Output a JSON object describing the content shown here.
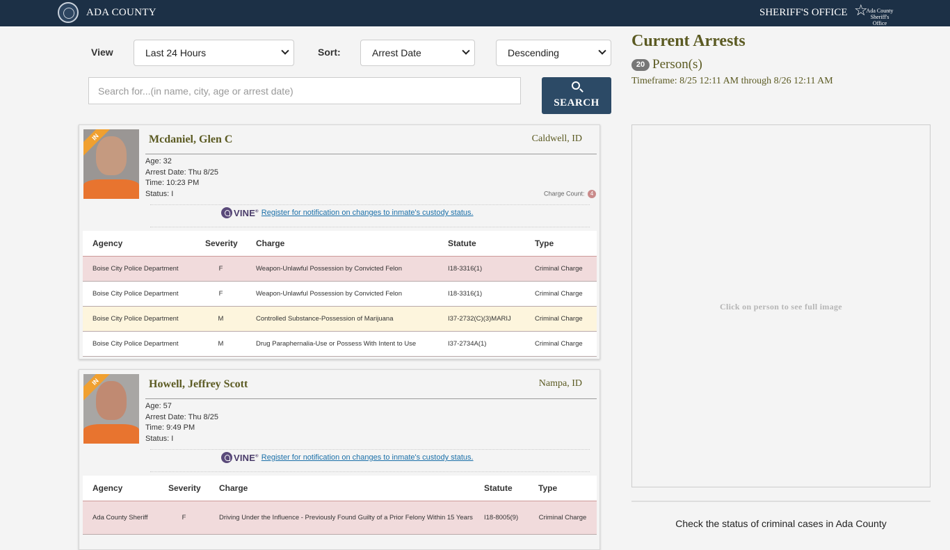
{
  "header": {
    "county": "ADA COUNTY",
    "office": "SHERIFF'S OFFICE",
    "logo_line1": "Ada County",
    "logo_line2": "Sheriff's Office"
  },
  "filters": {
    "view_label": "View",
    "view_value": "Last 24 Hours",
    "sort_label": "Sort:",
    "sort_value": "Arrest Date",
    "order_value": "Descending",
    "search_placeholder": "Search for...(in name, city, age or arrest date)",
    "search_button": "SEARCH"
  },
  "summary": {
    "title": "Current Arrests",
    "count": "20",
    "count_label": "Person(s)",
    "timeframe": "Timeframe: 8/25 12:11 AM through 8/26 12:11 AM"
  },
  "viewer": {
    "hint": "Click on person to see full image"
  },
  "footer": {
    "check_text": "Check the status of criminal cases in Ada County"
  },
  "columns": {
    "agency": "Agency",
    "severity": "Severity",
    "charge": "Charge",
    "statute": "Statute",
    "type": "Type"
  },
  "arrests": [
    {
      "status_ribbon": "IN",
      "name": "Mcdaniel, Glen C",
      "city": "Caldwell, ID",
      "age": "Age: 32",
      "arrest_date": "Arrest Date: Thu 8/25",
      "time": "Time: 10:23 PM",
      "status": "Status: I",
      "charge_count_label": "Charge Count:",
      "charge_count": "4",
      "vine_word": "VINE",
      "vine_link": "Register for notification on changes to inmate's custody status.",
      "charges": [
        {
          "agency": "Boise City Police Department",
          "severity": "F",
          "charge": "Weapon-Unlawful Possession by Convicted Felon",
          "statute": "I18-3316(1)",
          "type": "Criminal Charge"
        },
        {
          "agency": "Boise City Police Department",
          "severity": "F",
          "charge": "Weapon-Unlawful Possession by Convicted Felon",
          "statute": "I18-3316(1)",
          "type": "Criminal Charge"
        },
        {
          "agency": "Boise City Police Department",
          "severity": "M",
          "charge": "Controlled Substance-Possession of Marijuana",
          "statute": "I37-2732(C)(3)MARIJ",
          "type": "Criminal Charge"
        },
        {
          "agency": "Boise City Police Department",
          "severity": "M",
          "charge": "Drug Paraphernalia-Use or Possess With Intent to Use",
          "statute": "I37-2734A(1)",
          "type": "Criminal Charge"
        }
      ]
    },
    {
      "status_ribbon": "IN",
      "name": "Howell, Jeffrey Scott",
      "city": "Nampa, ID",
      "age": "Age: 57",
      "arrest_date": "Arrest Date: Thu 8/25",
      "time": "Time: 9:49 PM",
      "status": "Status: I",
      "vine_word": "VINE",
      "vine_link": "Register for notification on changes to inmate's custody status.",
      "charges": [
        {
          "agency": "Ada County Sheriff",
          "severity": "F",
          "charge": "Driving Under the Influence - Previously Found Guilty of a Prior Felony Within 15 Years",
          "statute": "I18-8005(9)",
          "type": "Criminal Charge"
        }
      ]
    }
  ]
}
